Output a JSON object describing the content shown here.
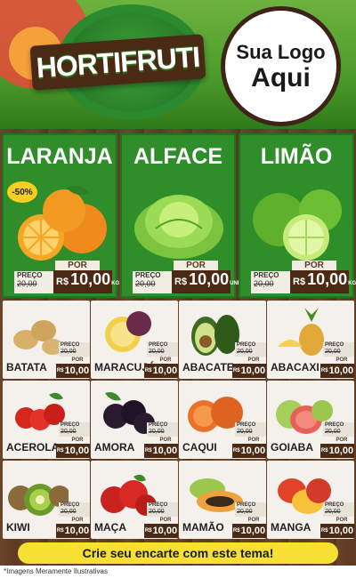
{
  "header": {
    "brand": "HORTIFRUTI",
    "logo_line1": "Sua Logo",
    "logo_line2": "Aqui"
  },
  "featured": [
    {
      "name": "LARANJA",
      "badge": "-50%",
      "preco_label": "PREÇO",
      "old_price": "20,00",
      "por": "POR",
      "currency": "R$",
      "price": "10,00",
      "unit": "KG"
    },
    {
      "name": "ALFACE",
      "preco_label": "PREÇO",
      "old_price": "20,00",
      "por": "POR",
      "currency": "R$",
      "price": "10,00",
      "unit": "UNID"
    },
    {
      "name": "LIMÃO",
      "preco_label": "PREÇO",
      "old_price": "20,00",
      "por": "POR",
      "currency": "R$",
      "price": "10,00",
      "unit": "KG"
    }
  ],
  "products": [
    {
      "name": "BATATA",
      "preco_label": "PREÇO",
      "old_price": "20,00",
      "por": "POR",
      "currency": "R$",
      "price": "10,00",
      "icon": "potato-icon"
    },
    {
      "name": "MARACUJÁ",
      "preco_label": "PREÇO",
      "old_price": "20,00",
      "por": "POR",
      "currency": "R$",
      "price": "10,00",
      "icon": "passion-fruit-icon"
    },
    {
      "name": "ABACATE",
      "preco_label": "PREÇO",
      "old_price": "20,00",
      "por": "POR",
      "currency": "R$",
      "price": "10,00",
      "icon": "avocado-icon"
    },
    {
      "name": "ABACAXI",
      "preco_label": "PREÇO",
      "old_price": "20,00",
      "por": "POR",
      "currency": "R$",
      "price": "10,00",
      "icon": "pineapple-icon"
    },
    {
      "name": "ACEROLA",
      "preco_label": "PREÇO",
      "old_price": "20,00",
      "por": "POR",
      "currency": "R$",
      "price": "10,00",
      "icon": "acerola-icon"
    },
    {
      "name": "AMORA",
      "preco_label": "PREÇO",
      "old_price": "20,00",
      "por": "POR",
      "currency": "R$",
      "price": "10,00",
      "icon": "blackberry-icon"
    },
    {
      "name": "CAQUI",
      "preco_label": "PREÇO",
      "old_price": "20,00",
      "por": "POR",
      "currency": "R$",
      "price": "10,00",
      "icon": "persimmon-icon"
    },
    {
      "name": "GOIABA",
      "preco_label": "PREÇO",
      "old_price": "20,00",
      "por": "POR",
      "currency": "R$",
      "price": "10,00",
      "icon": "guava-icon"
    },
    {
      "name": "KIWI",
      "preco_label": "PREÇO",
      "old_price": "20,00",
      "por": "POR",
      "currency": "R$",
      "price": "10,00",
      "icon": "kiwi-icon"
    },
    {
      "name": "MAÇA",
      "preco_label": "PREÇO",
      "old_price": "20,00",
      "por": "POR",
      "currency": "R$",
      "price": "10,00",
      "icon": "apple-icon"
    },
    {
      "name": "MAMÃO",
      "preco_label": "PREÇO",
      "old_price": "20,00",
      "por": "POR",
      "currency": "R$",
      "price": "10,00",
      "icon": "papaya-icon"
    },
    {
      "name": "MANGA",
      "preco_label": "PREÇO",
      "old_price": "20,00",
      "por": "POR",
      "currency": "R$",
      "price": "10,00",
      "icon": "mango-icon"
    }
  ],
  "footer": {
    "cta": "Crie seu encarte com este tema!",
    "note": "*Imagens Meramente Ilustrativas"
  },
  "colors": {
    "green": "#2f8d2a",
    "wood": "#5e3a22",
    "price_bg": "#4a2a14",
    "cta_yellow": "#f7e033"
  }
}
